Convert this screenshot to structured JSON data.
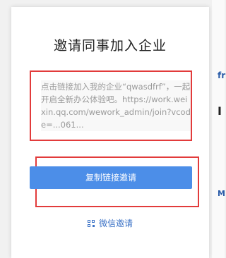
{
  "dialog": {
    "title": "邀请同事加入企业",
    "invite_text": "点击链接加入我的企业“qwasdfrf”，一起开启全新办公体验吧。https://work.weixin.qq.com/wework_admin/join?vcode=...061...",
    "copy_button_label": "复制链接邀请",
    "wechat_invite_label": "微信邀请"
  },
  "background": {
    "frag1": "fr",
    "frag2": "I",
    "frag3": "M"
  },
  "colors": {
    "accent": "#4c8ee8",
    "highlight_border": "#e23b3b",
    "link": "#3b72c6"
  }
}
